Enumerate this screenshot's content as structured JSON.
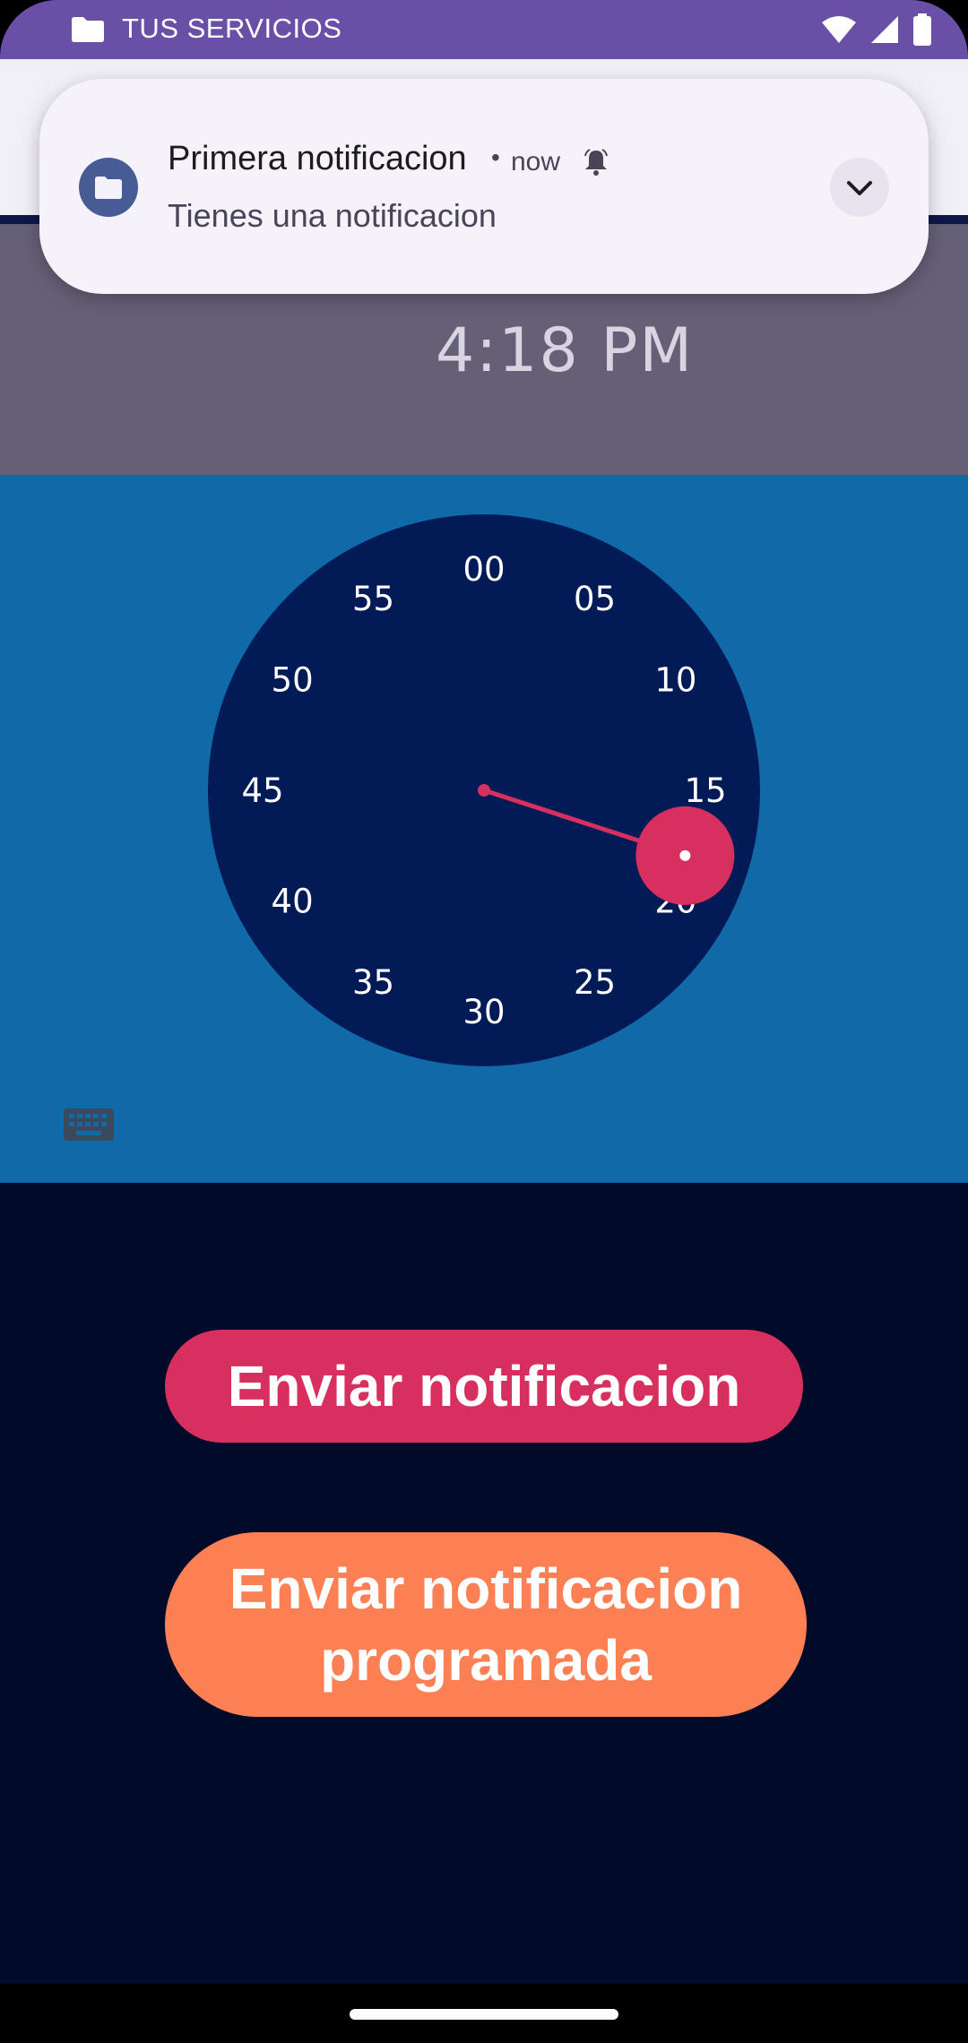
{
  "status_bar": {
    "title": "TUS SERVICIOS"
  },
  "notification": {
    "title": "Primera notificacion",
    "separator": "•",
    "time": "now",
    "text": "Tienes una notificacion"
  },
  "time_picker": {
    "time": "4:18 PM",
    "selected_minute": 18,
    "minute_labels": [
      "00",
      "05",
      "10",
      "15",
      "20",
      "25",
      "30",
      "35",
      "40",
      "45",
      "50",
      "55"
    ]
  },
  "buttons": {
    "send": "Enviar notificacion",
    "scheduled_line1": "Enviar notificacion",
    "scheduled_line2": "programada"
  },
  "colors": {
    "status_bar": "#6a4fa6",
    "clock_section": "#116aa8",
    "clock_face": "#021a56",
    "accent": "#d8305e",
    "scheduled_button": "#fd8055",
    "background": "#020a2a"
  },
  "icons": {
    "status_folder": "folder-icon",
    "wifi": "wifi-icon",
    "signal": "signal-icon",
    "battery": "battery-icon",
    "notif_app": "folder-icon",
    "notif_bell": "bell-icon",
    "expand": "chevron-down-icon",
    "keyboard": "keyboard-icon"
  }
}
